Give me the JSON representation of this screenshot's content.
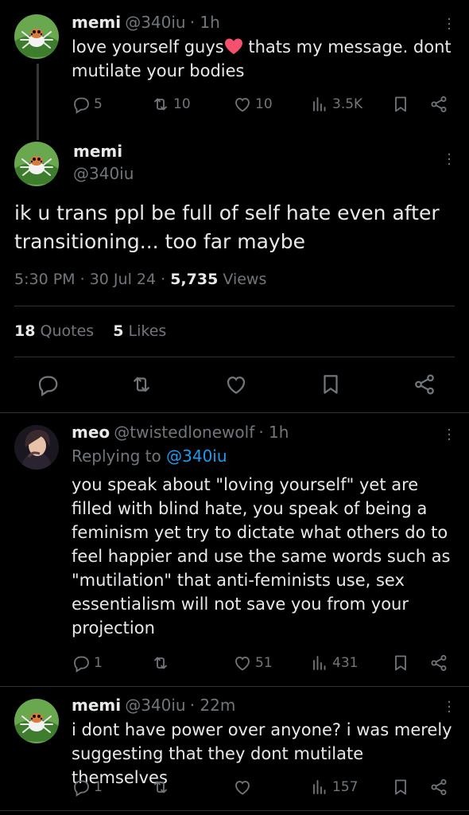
{
  "tweet1": {
    "name": "memi",
    "handle": "@340iu",
    "time": "· 1h",
    "text_a": "love yourself guys",
    "emoji": "heart-emoji",
    "text_b": " thats my message. dont mutilate your bodies",
    "replies": "5",
    "reposts": "10",
    "likes": "10",
    "views": "3.5K"
  },
  "main_tweet": {
    "name": "memi",
    "handle": "@340iu",
    "text": "ik u trans ppl be full of self hate even after transitioning... too far maybe",
    "time": "5:30 PM",
    "date": "30 Jul 24",
    "views_count": "5,735",
    "views_label": "Views",
    "quotes_count": "18",
    "quotes_label": "Quotes",
    "likes_count": "5",
    "likes_label": "Likes"
  },
  "reply1": {
    "name": "meo",
    "handle": "@twistedlonewolf",
    "time": "· 1h",
    "replying_prefix": "Replying to",
    "replying_to": "@340iu",
    "text": "you speak about \"loving yourself\" yet are filled with blind hate, you speak of being a feminism yet try to dictate what others do to feel happier and use the same words such as \"mutilation\" that anti-feminists use, sex essentialism will not save you from your projection",
    "replies": "1",
    "reposts": "",
    "likes": "51",
    "views": "431"
  },
  "reply2": {
    "name": "memi",
    "handle": "@340iu",
    "time": "· 22m",
    "text": "i dont have power over anyone? i was merely suggesting that they dont mutilate themselves",
    "replies": "1",
    "reposts": "",
    "likes": "",
    "views": "157"
  },
  "colors": {
    "background": "#000000",
    "text": "#e7e9ea",
    "muted": "#71767b",
    "link": "#1d9bf0",
    "divider": "#2f3336",
    "heart": "#f91880"
  }
}
